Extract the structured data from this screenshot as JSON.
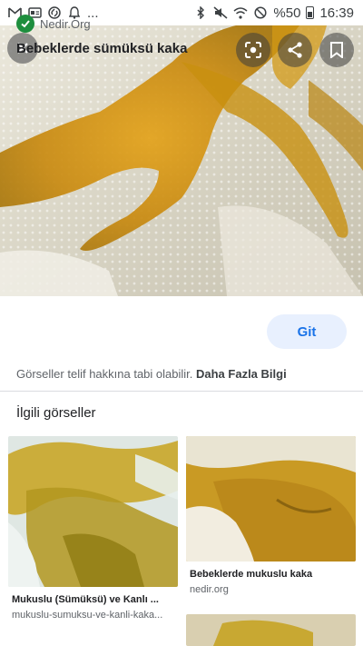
{
  "status_bar": {
    "battery_text": "%50",
    "time": "16:39",
    "left_icons": [
      "gmail-icon",
      "news-icon",
      "shazam-icon",
      "notification-icon",
      "more-dots-icon"
    ],
    "more_text": "..."
  },
  "viewer": {
    "close_icon": "close-icon",
    "lens_icon": "google-lens-icon",
    "share_icon": "share-icon",
    "save_icon": "bookmark-icon"
  },
  "info": {
    "source_name": "Nedir.Org",
    "title": "Bebeklerde sümüksü kaka",
    "go_label": "Git",
    "copyright_text": "Görseller telif hakkına tabi olabilir.",
    "more_info_label": "Daha Fazla Bilgi"
  },
  "related": {
    "heading": "İlgili görseller",
    "items": [
      {
        "title": "Mukuslu (Sümüksü) ve Kanlı ...",
        "source": "mukuslu-sumuksu-ve-kanli-kaka..."
      },
      {
        "title": "Bebeklerde mukuslu kaka",
        "source": "nedir.org"
      }
    ]
  },
  "colors": {
    "accent": "#1a73e8",
    "verified": "#1e8e3e",
    "button_bg": "#e8f0fe"
  }
}
